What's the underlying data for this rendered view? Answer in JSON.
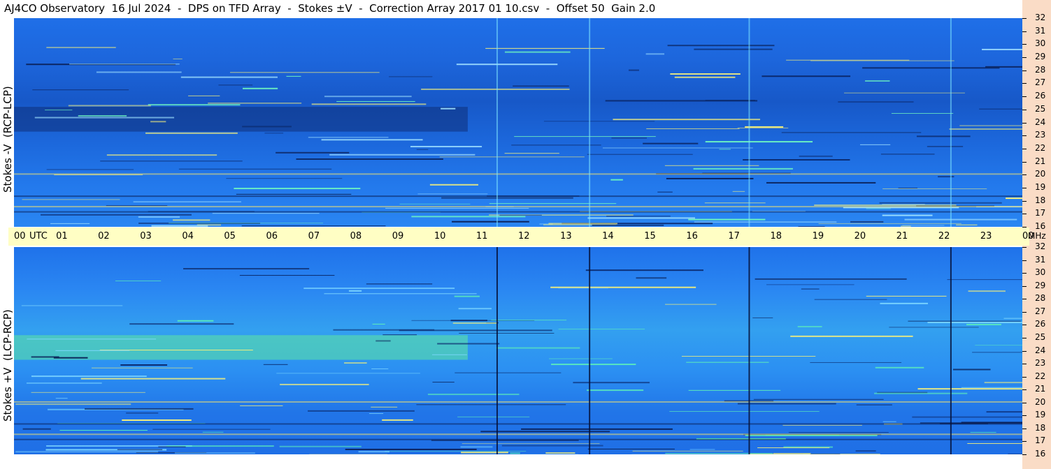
{
  "title": "AJ4CO Observatory  16 Jul 2024  -  DPS on TFD Array  -  Stokes ±V  -  Correction Array 2017 01 10.csv  -  Offset 50  Gain 2.0",
  "colors": {
    "background_low": "#1758c8",
    "background_mid": "#2379ec",
    "background_high": "#33a0f0",
    "time_axis_bar": "#fffec4",
    "frequency_strip": "#fadcc6"
  },
  "chart_data": [
    {
      "type": "heatmap",
      "panel": "top",
      "ylabel": "Stokes -V  (RCP-LCP)",
      "x_ticks": [
        "00",
        "01",
        "02",
        "03",
        "04",
        "05",
        "06",
        "07",
        "08",
        "09",
        "10",
        "11",
        "12",
        "13",
        "14",
        "15",
        "16",
        "17",
        "18",
        "19",
        "20",
        "21",
        "22",
        "23",
        "00"
      ],
      "x_unit_label": "UTC",
      "xlim": [
        0,
        24
      ],
      "y_ticks": [
        "16",
        "17",
        "18",
        "19",
        "20",
        "21",
        "22",
        "23",
        "24",
        "25",
        "26",
        "27",
        "28",
        "29",
        "30",
        "31",
        "32"
      ],
      "y_unit_label": "MHz",
      "ylim": [
        16,
        32
      ],
      "vertical_events_utc": [
        11.5,
        13.7,
        17.5,
        22.3
      ],
      "dark_band": {
        "utc_start": 0,
        "utc_end": 10.8,
        "mhz_low": 23.3,
        "mhz_high": 25.2
      }
    },
    {
      "type": "heatmap",
      "panel": "bottom",
      "ylabel": "Stokes +V  (LCP-RCP)",
      "x_ticks": [
        "00",
        "01",
        "02",
        "03",
        "04",
        "05",
        "06",
        "07",
        "08",
        "09",
        "10",
        "11",
        "12",
        "13",
        "14",
        "15",
        "16",
        "17",
        "18",
        "19",
        "20",
        "21",
        "22",
        "23",
        "00"
      ],
      "x_unit_label": "UTC",
      "xlim": [
        0,
        24
      ],
      "y_ticks": [
        "16",
        "17",
        "18",
        "19",
        "20",
        "21",
        "22",
        "23",
        "24",
        "25",
        "26",
        "27",
        "28",
        "29",
        "30",
        "31",
        "32"
      ],
      "y_unit_label": "MHz",
      "ylim": [
        16,
        32
      ],
      "vertical_events_utc": [
        11.5,
        13.7,
        17.5,
        22.3
      ],
      "bright_band": {
        "utc_start": 0,
        "utc_end": 10.8,
        "mhz_low": 23.3,
        "mhz_high": 25.2
      }
    }
  ]
}
